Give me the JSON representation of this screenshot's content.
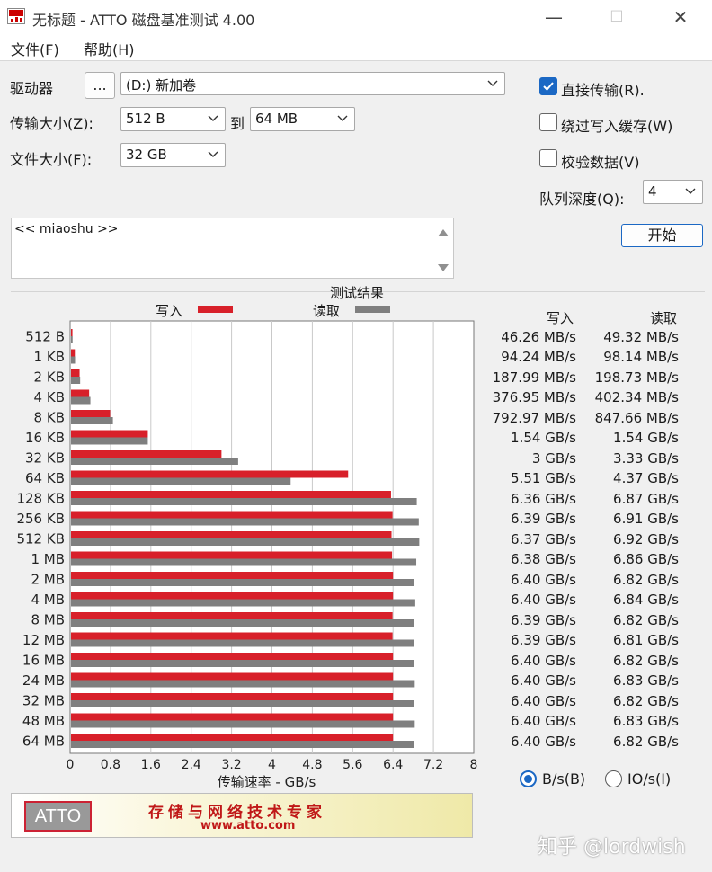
{
  "window": {
    "title": "无标题 - ATTO 磁盘基准测试 4.00",
    "minimize": "—",
    "maximize": "☐",
    "close": "✕"
  },
  "menu": [
    "文件(F)",
    "帮助(H)"
  ],
  "controls": {
    "drive_label": "驱动器",
    "browse_label": "...",
    "drive_value": "(D:) 新加卷",
    "transfer_label": "传输大小(Z):",
    "transfer_from": "512 B",
    "to_label": "到",
    "transfer_to": "64 MB",
    "filesize_label": "文件大小(F):",
    "filesize_value": "32 GB",
    "direct_io": {
      "label": "直接传输(R).",
      "checked": true
    },
    "bypass_cache": {
      "label": "绕过写入缓存(W)",
      "checked": false
    },
    "verify": {
      "label": "校验数据(V)",
      "checked": false
    },
    "queue_label": "队列深度(Q):",
    "queue_value": "4",
    "start_label": "开始",
    "description": "<< miaoshu >>"
  },
  "results": {
    "title": "测试结果",
    "legend_write": "写入",
    "legend_read": "读取",
    "col_write": "写入",
    "col_read": "读取",
    "write_values": [
      "46.26 MB/s",
      "94.24 MB/s",
      "187.99 MB/s",
      "376.95 MB/s",
      "792.97 MB/s",
      "1.54 GB/s",
      "3 GB/s",
      "5.51 GB/s",
      "6.36 GB/s",
      "6.39 GB/s",
      "6.37 GB/s",
      "6.38 GB/s",
      "6.40 GB/s",
      "6.40 GB/s",
      "6.39 GB/s",
      "6.39 GB/s",
      "6.40 GB/s",
      "6.40 GB/s",
      "6.40 GB/s",
      "6.40 GB/s",
      "6.40 GB/s"
    ],
    "read_values": [
      "49.32 MB/s",
      "98.14 MB/s",
      "198.73 MB/s",
      "402.34 MB/s",
      "847.66 MB/s",
      "1.54 GB/s",
      "3.33 GB/s",
      "4.37 GB/s",
      "6.87 GB/s",
      "6.91 GB/s",
      "6.92 GB/s",
      "6.86 GB/s",
      "6.82 GB/s",
      "6.84 GB/s",
      "6.82 GB/s",
      "6.81 GB/s",
      "6.82 GB/s",
      "6.83 GB/s",
      "6.82 GB/s",
      "6.83 GB/s",
      "6.82 GB/s"
    ],
    "units_bs": {
      "label": "B/s(B)",
      "selected": true
    },
    "units_ios": {
      "label": "IO/s(I)",
      "selected": false
    }
  },
  "chart_data": {
    "type": "bar",
    "orientation": "horizontal",
    "categories": [
      "512 B",
      "1 KB",
      "2 KB",
      "4 KB",
      "8 KB",
      "16 KB",
      "32 KB",
      "64 KB",
      "128 KB",
      "256 KB",
      "512 KB",
      "1 MB",
      "2 MB",
      "4 MB",
      "8 MB",
      "12 MB",
      "16 MB",
      "24 MB",
      "32 MB",
      "48 MB",
      "64 MB"
    ],
    "series": [
      {
        "name": "写入",
        "color": "#d8202a",
        "values": [
          0.046,
          0.094,
          0.188,
          0.377,
          0.793,
          1.54,
          3.0,
          5.51,
          6.36,
          6.39,
          6.37,
          6.38,
          6.4,
          6.4,
          6.39,
          6.39,
          6.4,
          6.4,
          6.4,
          6.4,
          6.4
        ]
      },
      {
        "name": "读取",
        "color": "#7f7f7f",
        "values": [
          0.049,
          0.098,
          0.199,
          0.402,
          0.848,
          1.54,
          3.33,
          4.37,
          6.87,
          6.91,
          6.92,
          6.86,
          6.82,
          6.84,
          6.82,
          6.81,
          6.82,
          6.83,
          6.82,
          6.83,
          6.82
        ]
      }
    ],
    "xticks": [
      "0",
      "0.8",
      "1.6",
      "2.4",
      "3.2",
      "4",
      "4.8",
      "5.6",
      "6.4",
      "7.2",
      "8"
    ],
    "xlim": [
      0,
      8
    ],
    "xlabel": "传输速率 - GB/s",
    "grid": true
  },
  "banner": {
    "logo": "ATTO",
    "slogan": "存储与网络技术专家",
    "site": "www.atto.com"
  },
  "watermark": "知乎 @lordwish"
}
